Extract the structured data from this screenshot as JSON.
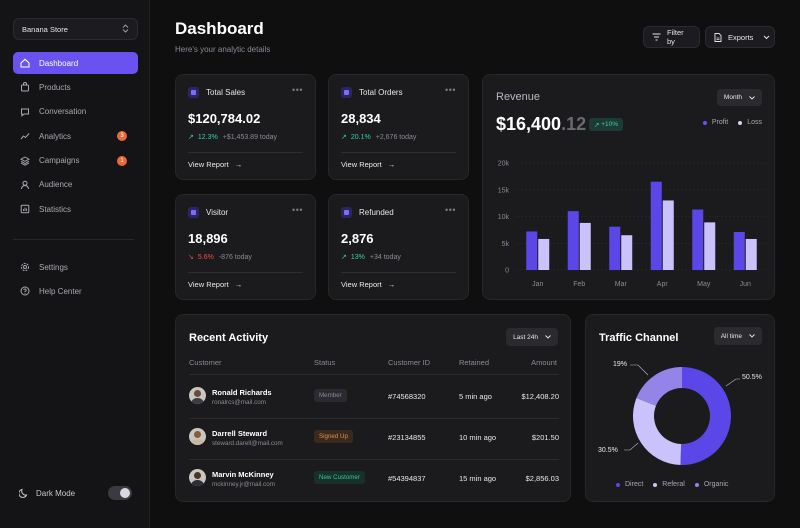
{
  "sidebar": {
    "store_name": "Banana Store",
    "nav": [
      {
        "label": "Dashboard",
        "icon": "home-icon",
        "active": true
      },
      {
        "label": "Products",
        "icon": "bag-icon"
      },
      {
        "label": "Conversation",
        "icon": "chat-icon"
      },
      {
        "label": "Analytics",
        "icon": "analytics-icon",
        "badge": "3"
      },
      {
        "label": "Campaigns",
        "icon": "layers-icon",
        "badge": "1"
      },
      {
        "label": "Audience",
        "icon": "user-icon"
      },
      {
        "label": "Statistics",
        "icon": "statistics-icon"
      }
    ],
    "nav2": [
      {
        "label": "Settings",
        "icon": "gear-icon"
      },
      {
        "label": "Help Center",
        "icon": "help-icon"
      }
    ],
    "dark_mode_label": "Dark Mode"
  },
  "header": {
    "title": "Dashboard",
    "subtitle": "Here's your analytic details",
    "filter_label": "Filter by",
    "exports_label": "Exports"
  },
  "stats": [
    {
      "title": "Total Sales",
      "value": "$120,784.02",
      "trend": "up",
      "pct": "12.3%",
      "delta": "+$1,453.89 today",
      "link": "View Report"
    },
    {
      "title": "Total Orders",
      "value": "28,834",
      "trend": "up",
      "pct": "20.1%",
      "delta": "+2,676 today",
      "link": "View Report"
    },
    {
      "title": "Visitor",
      "value": "18,896",
      "trend": "down",
      "pct": "5.6%",
      "delta": "-876 today",
      "link": "View Report"
    },
    {
      "title": "Refunded",
      "value": "2,876",
      "trend": "up",
      "pct": "13%",
      "delta": "+34 today",
      "link": "View Report"
    }
  ],
  "revenue": {
    "title": "Revenue",
    "value_main": "$16,400",
    "value_dec": ".12",
    "change": "+10%",
    "period": "Month"
  },
  "chart_data": {
    "type": "bar",
    "categories": [
      "Jan",
      "Feb",
      "Mar",
      "Apr",
      "May",
      "Jun"
    ],
    "series": [
      {
        "name": "Profit",
        "values": [
          7200,
          11000,
          8100,
          16500,
          11300,
          7100
        ]
      },
      {
        "name": "Loss",
        "values": [
          5800,
          8800,
          6500,
          13000,
          8900,
          5800
        ]
      }
    ],
    "ylim": [
      0,
      20000
    ],
    "yticks": [
      "0",
      "5k",
      "10k",
      "15k",
      "20k"
    ],
    "legend_position": "top-right",
    "colors": {
      "profit": "#5b47e8",
      "loss": "#c9c2fb"
    }
  },
  "activity": {
    "title": "Recent Activity",
    "filter": "Last 24h",
    "columns": [
      "Customer",
      "Status",
      "Customer ID",
      "Retained",
      "Amount"
    ],
    "rows": [
      {
        "name": "Ronald Richards",
        "email": "ronalrcs@mail.com",
        "status": "Member",
        "status_type": "member",
        "id": "#74568320",
        "retained": "5 min ago",
        "amount": "$12,408.20"
      },
      {
        "name": "Darrell Steward",
        "email": "steward.darell@mail.com",
        "status": "Signed Up",
        "status_type": "signed",
        "id": "#23134855",
        "retained": "10 min ago",
        "amount": "$201.50"
      },
      {
        "name": "Marvin McKinney",
        "email": "mckinney.jr@mail.com",
        "status": "New Customer",
        "status_type": "newc",
        "id": "#54394837",
        "retained": "15 min ago",
        "amount": "$2,856.03"
      }
    ]
  },
  "traffic": {
    "title": "Traffic Channel",
    "filter": "All time",
    "slices": [
      {
        "name": "Direct",
        "value": 50.5,
        "label": "50.5%",
        "color": "#5b47e8"
      },
      {
        "name": "Referal",
        "value": 30.5,
        "label": "30.5%",
        "color": "#c9c2fb"
      },
      {
        "name": "Organic",
        "value": 19,
        "label": "19%",
        "color": "#9484e8"
      }
    ]
  }
}
